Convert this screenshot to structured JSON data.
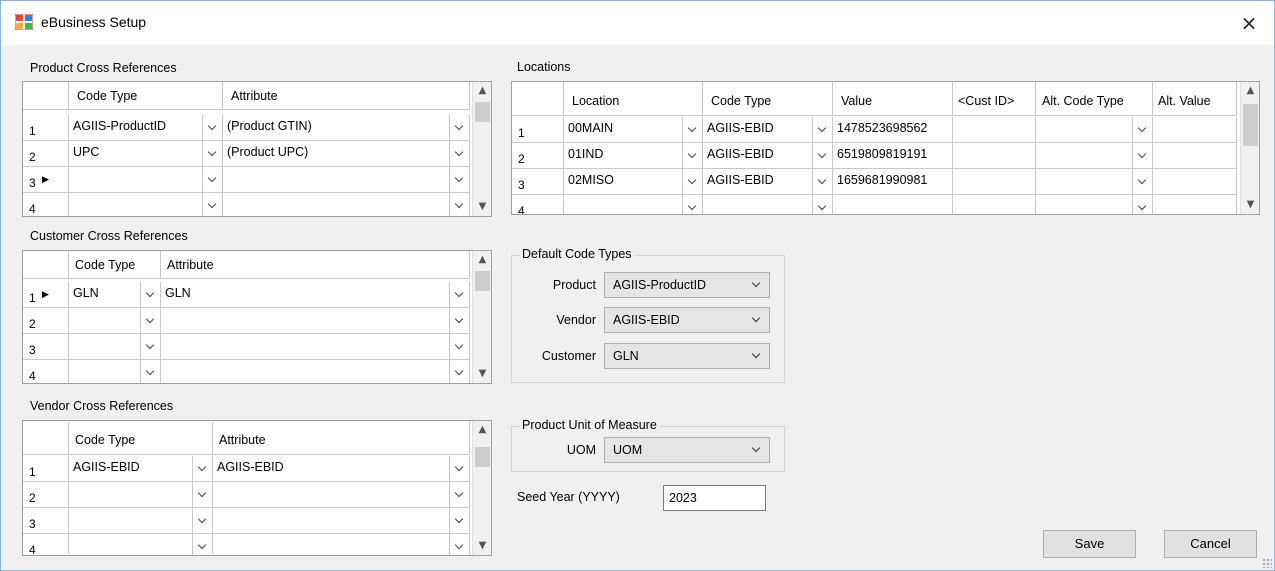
{
  "window": {
    "title": "eBusiness Setup"
  },
  "product_xref": {
    "label": "Product Cross References",
    "headers": [
      "Code Type",
      "Attribute"
    ],
    "rows": [
      {
        "num": "1",
        "code_type": "AGIIS-ProductID",
        "attribute": "(Product GTIN)"
      },
      {
        "num": "2",
        "code_type": "UPC",
        "attribute": "(Product UPC)"
      },
      {
        "num": "3",
        "code_type": "",
        "attribute": ""
      },
      {
        "num": "4",
        "code_type": "",
        "attribute": ""
      }
    ]
  },
  "customer_xref": {
    "label": "Customer Cross References",
    "headers": [
      "Code Type",
      "Attribute"
    ],
    "rows": [
      {
        "num": "1",
        "code_type": "GLN",
        "attribute": "GLN"
      },
      {
        "num": "2",
        "code_type": "",
        "attribute": ""
      },
      {
        "num": "3",
        "code_type": "",
        "attribute": ""
      },
      {
        "num": "4",
        "code_type": "",
        "attribute": ""
      }
    ]
  },
  "vendor_xref": {
    "label": "Vendor Cross References",
    "headers": [
      "Code Type",
      "Attribute"
    ],
    "rows": [
      {
        "num": "1",
        "code_type": "AGIIS-EBID",
        "attribute": "AGIIS-EBID"
      },
      {
        "num": "2",
        "code_type": "",
        "attribute": ""
      },
      {
        "num": "3",
        "code_type": "",
        "attribute": ""
      },
      {
        "num": "4",
        "code_type": "",
        "attribute": ""
      }
    ]
  },
  "locations": {
    "label": "Locations",
    "headers": [
      "Location",
      "Code Type",
      "Value",
      "<Cust ID>",
      "Alt. Code Type",
      "Alt. Value"
    ],
    "rows": [
      {
        "num": "1",
        "location": "00MAIN",
        "code_type": "AGIIS-EBID",
        "value": "1478523698562"
      },
      {
        "num": "2",
        "location": "01IND",
        "code_type": "AGIIS-EBID",
        "value": "6519809819191"
      },
      {
        "num": "3",
        "location": "02MISO",
        "code_type": "AGIIS-EBID",
        "value": "1659681990981"
      },
      {
        "num": "4",
        "location": "",
        "code_type": "",
        "value": ""
      }
    ]
  },
  "default_code_types": {
    "label": "Default Code Types",
    "product_label": "Product",
    "product_value": "AGIIS-ProductID",
    "vendor_label": "Vendor",
    "vendor_value": "AGIIS-EBID",
    "customer_label": "Customer",
    "customer_value": "GLN"
  },
  "uom_group": {
    "label": "Product Unit of Measure",
    "uom_label": "UOM",
    "uom_value": "UOM"
  },
  "seed_year": {
    "label": "Seed Year (YYYY)",
    "value": "2023"
  },
  "buttons": {
    "save": "Save",
    "cancel": "Cancel"
  },
  "icons": {
    "close": "×",
    "up": "▲",
    "down": "▼",
    "row_pointer": "▶"
  }
}
